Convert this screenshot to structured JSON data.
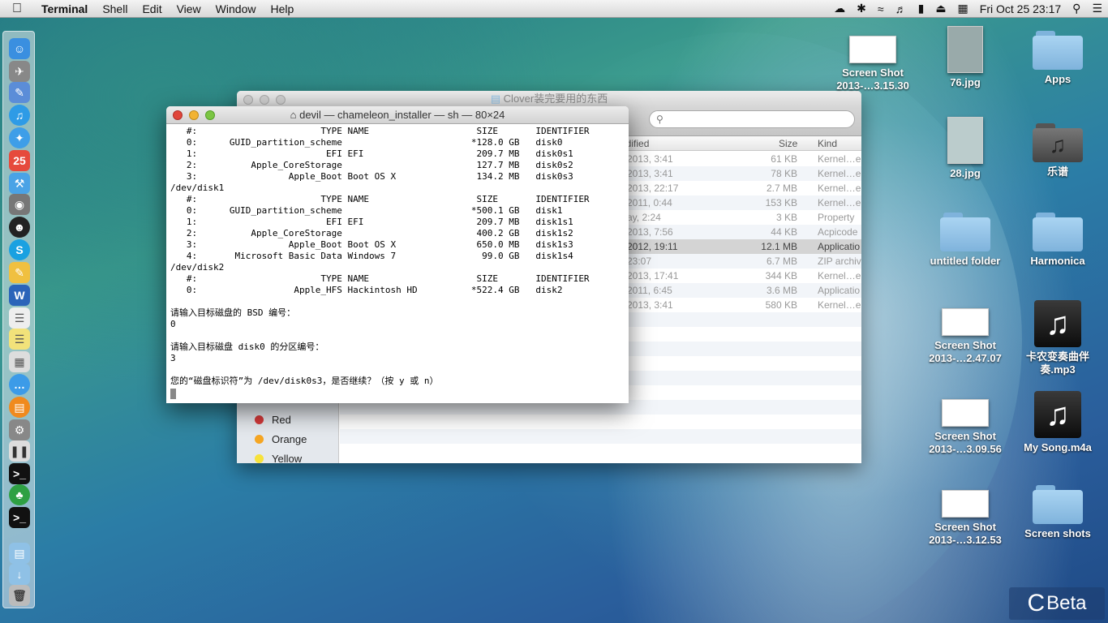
{
  "menubar": {
    "app_name": "Terminal",
    "items": [
      "Shell",
      "Edit",
      "View",
      "Window",
      "Help"
    ],
    "clock": "Fri Oct 25  23:17"
  },
  "finder": {
    "title": "Clover装完要用的东西",
    "columns": {
      "modified": "odified",
      "size": "Size",
      "kind": "Kind"
    },
    "rows": [
      {
        "date": "2013, 3:41",
        "size": "61 KB",
        "kind": "Kernel…e"
      },
      {
        "date": "2013, 3:41",
        "size": "78 KB",
        "kind": "Kernel…e"
      },
      {
        "date": "2013, 22:17",
        "size": "2.7 MB",
        "kind": "Kernel…e"
      },
      {
        "date": "2011, 0:44",
        "size": "153 KB",
        "kind": "Kernel…e"
      },
      {
        "date": "ay, 2:24",
        "size": "3 KB",
        "kind": "Property"
      },
      {
        "date": "2013, 7:56",
        "size": "44 KB",
        "kind": "Acpicode"
      },
      {
        "date": "2012, 19:11",
        "size": "12.1 MB",
        "kind": "Applicatio"
      },
      {
        "date": "23:07",
        "size": "6.7 MB",
        "kind": "ZIP archiv"
      },
      {
        "date": "2013, 17:41",
        "size": "344 KB",
        "kind": "Kernel…e"
      },
      {
        "date": "2011, 6:45",
        "size": "3.6 MB",
        "kind": "Applicatio"
      },
      {
        "date": "2013, 3:41",
        "size": "580 KB",
        "kind": "Kernel…e"
      }
    ],
    "tags": [
      "Red",
      "Orange",
      "Yellow"
    ]
  },
  "terminal": {
    "title": "devil — chameleon_installer — sh — 80×24",
    "output": "   #:                       TYPE NAME                    SIZE       IDENTIFIER\n   0:      GUID_partition_scheme                        *128.0 GB   disk0\n   1:                        EFI EFI                     209.7 MB   disk0s1\n   2:          Apple_CoreStorage                         127.7 MB   disk0s2\n   3:                 Apple_Boot Boot OS X               134.2 MB   disk0s3\n/dev/disk1\n   #:                       TYPE NAME                    SIZE       IDENTIFIER\n   0:      GUID_partition_scheme                        *500.1 GB   disk1\n   1:                        EFI EFI                     209.7 MB   disk1s1\n   2:          Apple_CoreStorage                         400.2 GB   disk1s2\n   3:                 Apple_Boot Boot OS X               650.0 MB   disk1s3\n   4:       Microsoft Basic Data Windows 7                99.0 GB   disk1s4\n/dev/disk2\n   #:                       TYPE NAME                    SIZE       IDENTIFIER\n   0:                  Apple_HFS Hackintosh HD          *522.4 GB   disk2\n\n请输入目标磁盘的 BSD 编号：\n0\n\n请输入目标磁盘 disk0 的分区编号：\n3\n\n您的“磁盘标识符”为 /dev/disk0s3，是否继续？（按 y 或 n）"
  },
  "desktop": {
    "icons": [
      {
        "name": "Screen Shot\n2013-…3.15.30"
      },
      {
        "name": "76.jpg"
      },
      {
        "name": "Apps"
      },
      {
        "name": "28.jpg"
      },
      {
        "name": "乐谱"
      },
      {
        "name": "untitled folder"
      },
      {
        "name": "Harmonica"
      },
      {
        "name": "Screen Shot\n2013-…2.47.07"
      },
      {
        "name": "卡农变奏曲伴\n奏.mp3"
      },
      {
        "name": "Screen Shot\n2013-…3.09.56"
      },
      {
        "name": "My Song.m4a"
      },
      {
        "name": "Screen Shot\n2013-…3.12.53"
      },
      {
        "name": "Screen shots"
      }
    ]
  },
  "watermark": "Beta",
  "colors": {
    "accent": "#2a7fd0",
    "folder": "#8fc1e6",
    "tag_red": "#d43a3a",
    "tag_orange": "#f5a623",
    "tag_yellow": "#f7e23b"
  }
}
